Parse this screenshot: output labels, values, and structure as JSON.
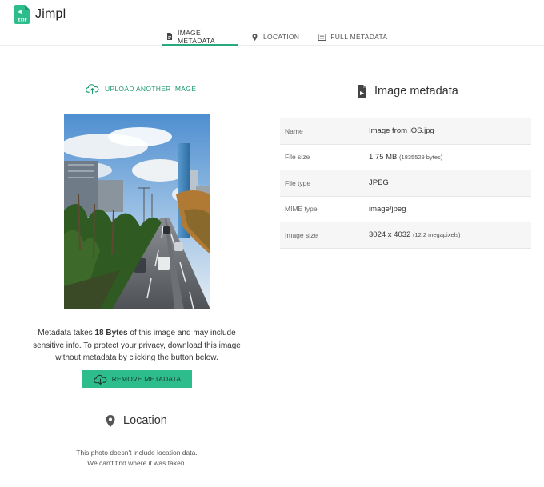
{
  "app": {
    "name": "Jimpl",
    "logo_badge": "EXIF"
  },
  "tabs": [
    {
      "label": "IMAGE METADATA",
      "icon": "document-icon",
      "active": true
    },
    {
      "label": "LOCATION",
      "icon": "map-pin-icon",
      "active": false
    },
    {
      "label": "FULL METADATA",
      "icon": "list-icon",
      "active": false
    }
  ],
  "upload": {
    "label": "UPLOAD ANOTHER IMAGE",
    "icon": "cloud-upload-icon"
  },
  "privacy": {
    "before": "Metadata takes ",
    "size": "18 Bytes",
    "after": " of this image and may include sensitive info. To protect your privacy, download this image without metadata by clicking the button below."
  },
  "remove_button": {
    "label": "REMOVE METADATA",
    "icon": "cloud-download-icon"
  },
  "location": {
    "heading": "Location",
    "line1": "This photo doesn't include location data.",
    "line2": "We can't find where it was taken."
  },
  "metadata": {
    "heading": "Image metadata",
    "rows": [
      {
        "key": "Name",
        "value": "Image from iOS.jpg",
        "extra": ""
      },
      {
        "key": "File size",
        "value": "1.75 MB",
        "extra": "(1835529 bytes)"
      },
      {
        "key": "File type",
        "value": "JPEG",
        "extra": ""
      },
      {
        "key": "MIME type",
        "value": "image/jpeg",
        "extra": ""
      },
      {
        "key": "Image size",
        "value": "3024 x 4032",
        "extra": "(12.2 megapixels)"
      }
    ]
  },
  "colors": {
    "accent": "#2aa980",
    "button": "#2dbd8d",
    "link": "#1f9a72"
  }
}
